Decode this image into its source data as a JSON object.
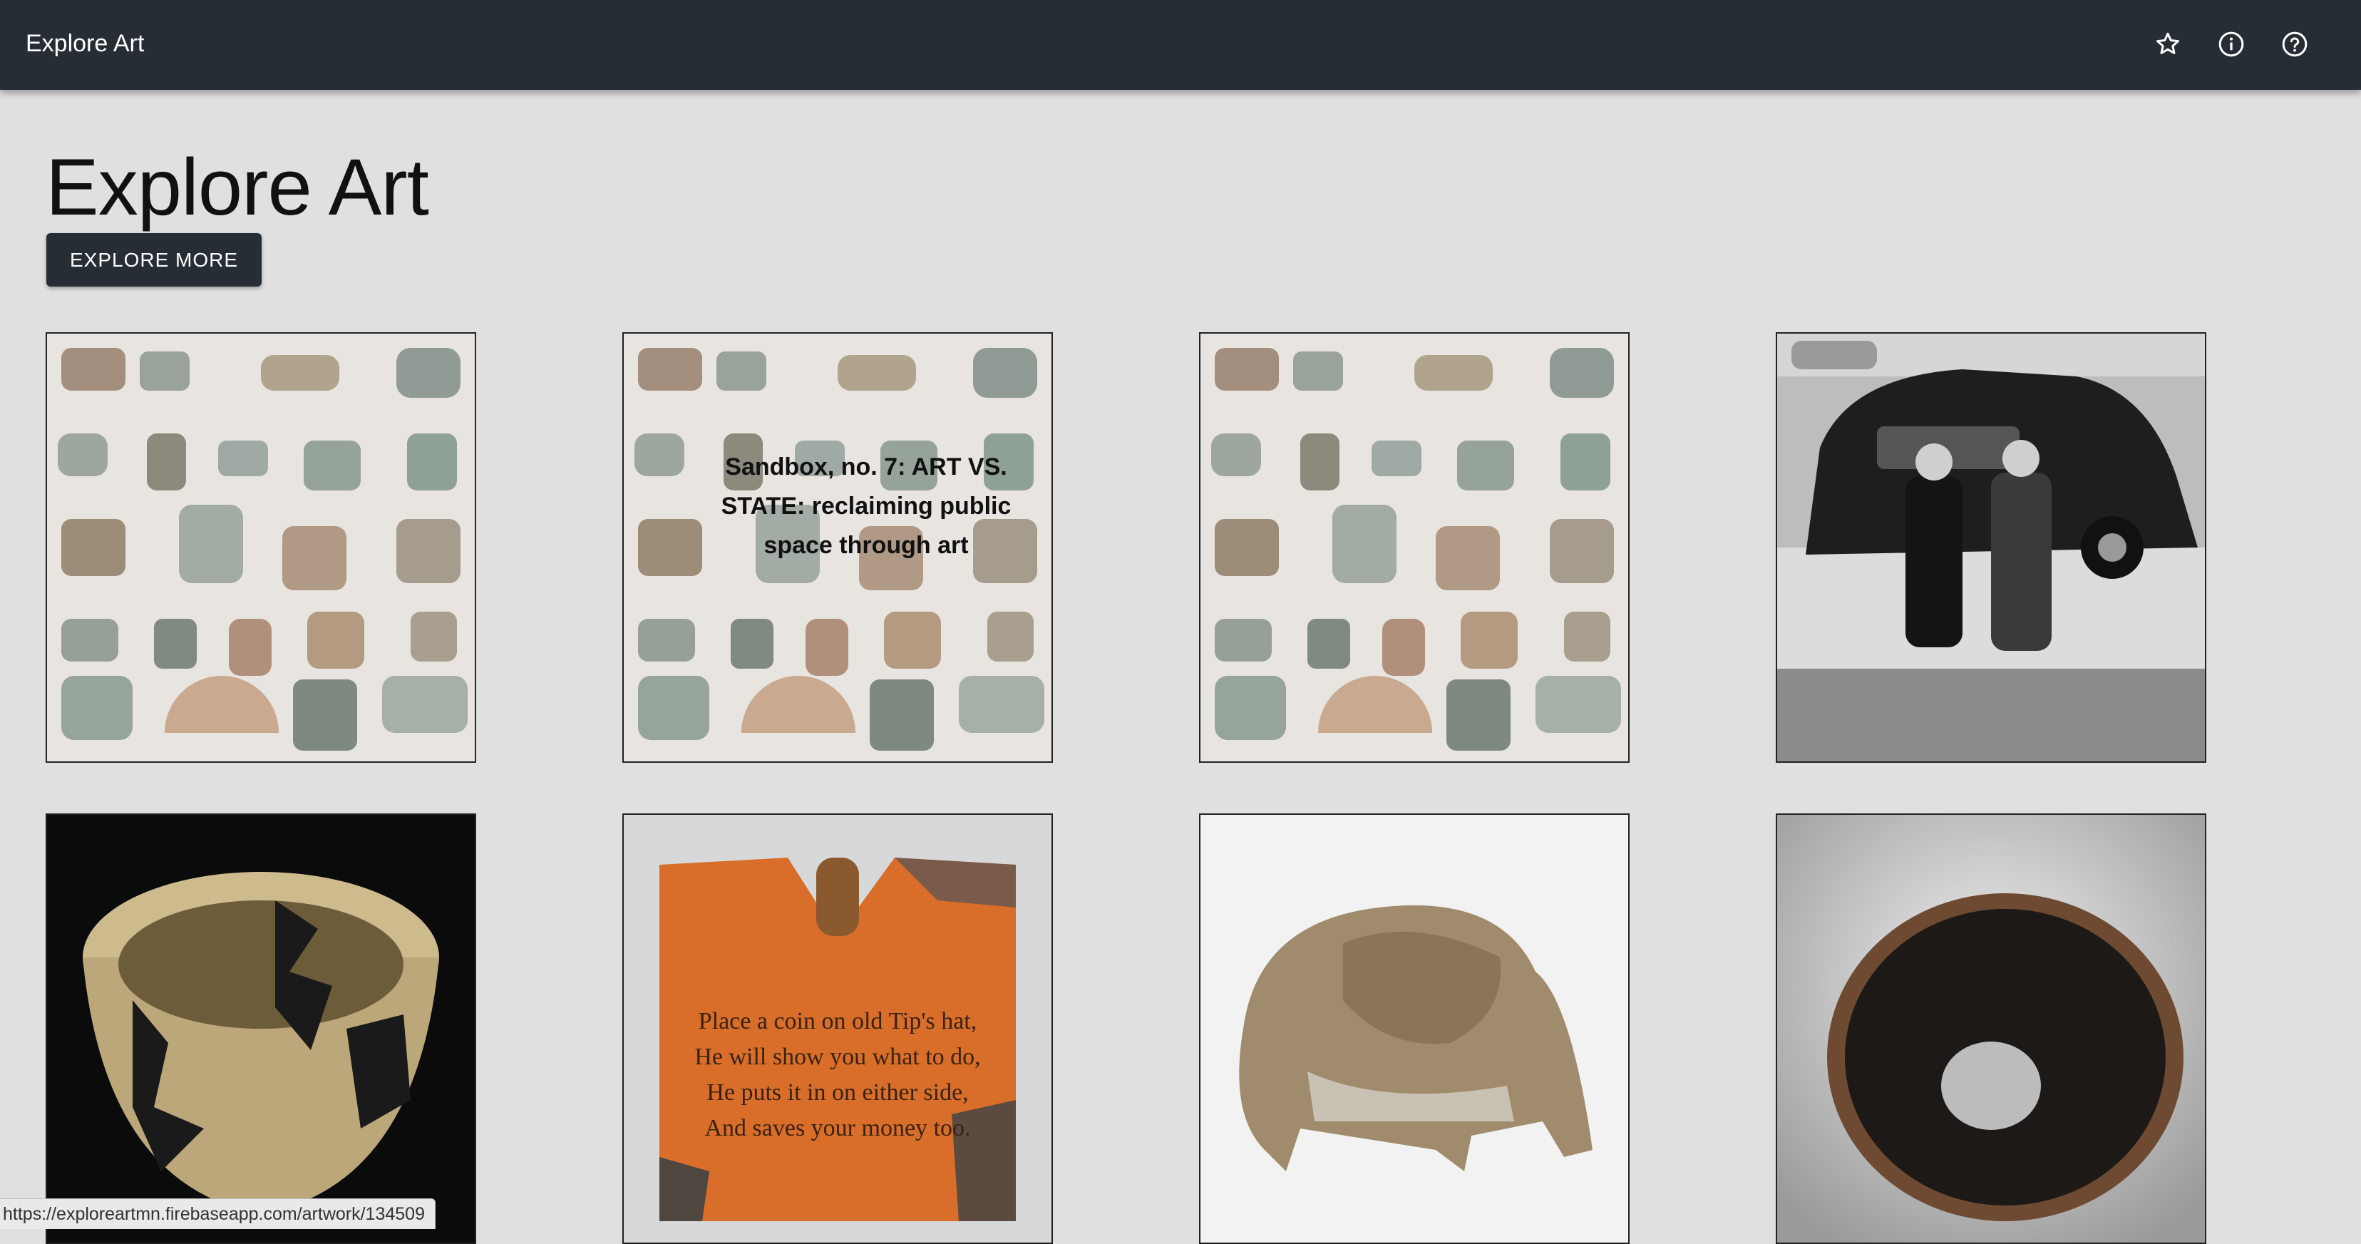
{
  "appbar": {
    "title": "Explore Art",
    "icons": [
      "star-outline-icon",
      "info-icon",
      "help-icon"
    ]
  },
  "main": {
    "heading": "Explore Art",
    "explore_button": "EXPLORE MORE"
  },
  "artworks": [
    {
      "subject": "ceramic shards on white cloth",
      "caption": ""
    },
    {
      "subject": "ceramic shards on white cloth",
      "caption": "Sandbox, no. 7: ART VS. STATE: reclaiming public space through art"
    },
    {
      "subject": "ceramic shards on white cloth",
      "caption": ""
    },
    {
      "subject": "two men standing in front of a car, black and white photo",
      "caption": ""
    },
    {
      "subject": "woven basket with dark pattern",
      "caption": ""
    },
    {
      "subject": "orange wooden coin bank",
      "caption": "",
      "inscription": [
        "Place a coin on old Tip's hat,",
        "He will show you what to do,",
        "He puts it in on either side,",
        "And saves your money too."
      ]
    },
    {
      "subject": "carved jade animal figure",
      "caption": ""
    },
    {
      "subject": "dark glazed tea bowl",
      "caption": ""
    }
  ],
  "status_bar": {
    "url": "https://exploreartmn.firebaseapp.com/artwork/134509"
  },
  "colors": {
    "appbar": "#272d35",
    "background": "#e0e0e0",
    "button": "#272d35"
  }
}
